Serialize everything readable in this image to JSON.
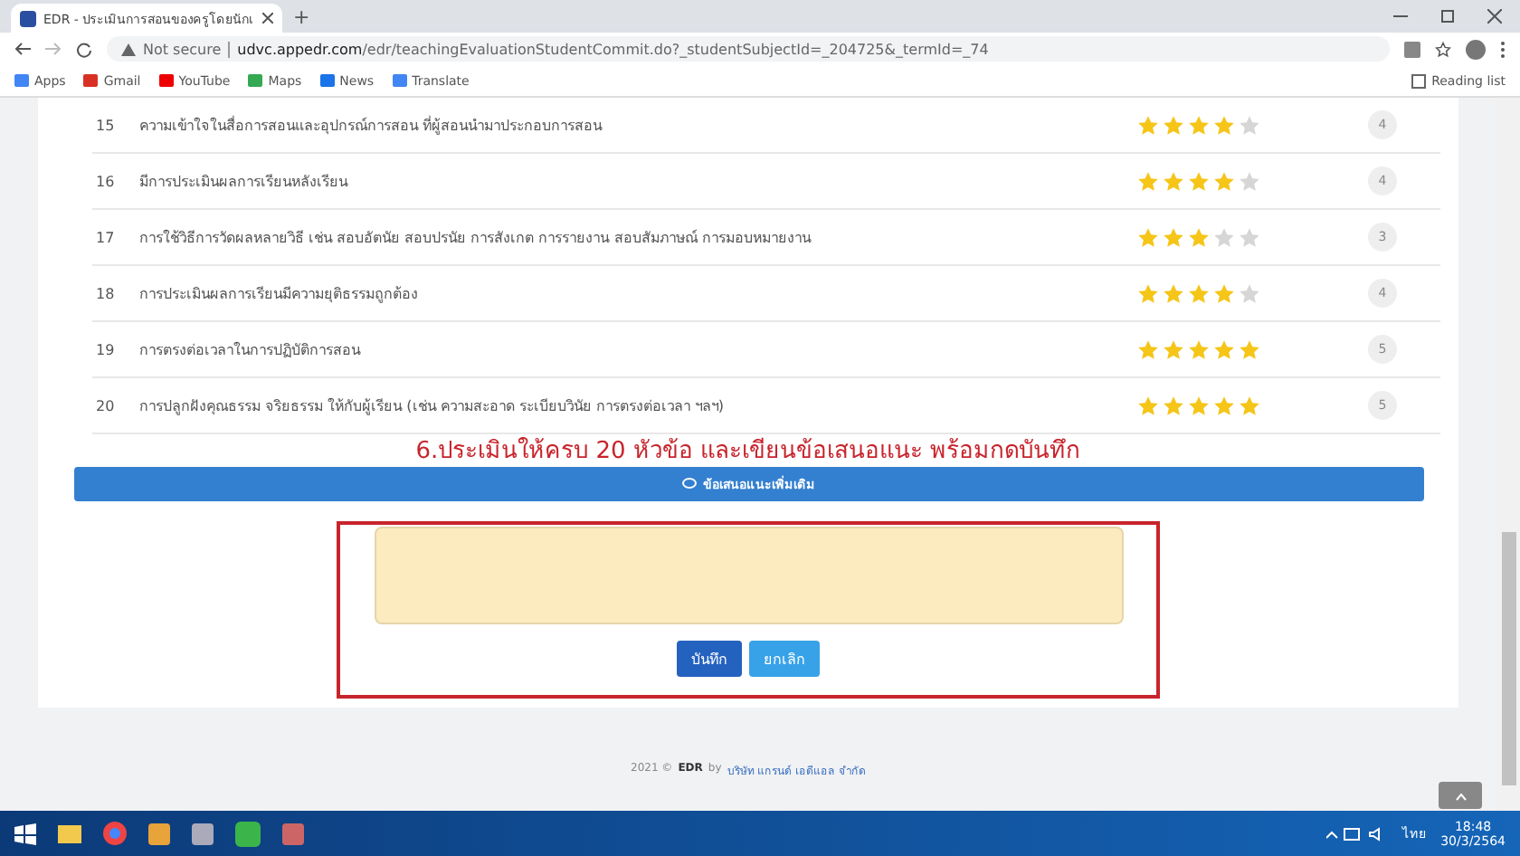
{
  "browser": {
    "tab_title": "EDR - ประเมินการสอนของครูโดยนักเ",
    "new_tab": "+",
    "url_warning": "Not secure",
    "url_host": "udvc.appedr.com",
    "url_path": "/edr/teachingEvaluationStudentCommit.do?_studentSubjectId=_204725&_termId=_74",
    "bookmarks": [
      "Apps",
      "Gmail",
      "YouTube",
      "Maps",
      "News",
      "Translate"
    ],
    "reading_list": "Reading list"
  },
  "questions": [
    {
      "number": "15",
      "text": "ความเข้าใจในสื่อการสอนและอุปกรณ์การสอน ที่ผู้สอนนำมาประกอบการสอน",
      "stars": 4,
      "score": "4"
    },
    {
      "number": "16",
      "text": "มีการประเมินผลการเรียนหลังเรียน",
      "stars": 4,
      "score": "4"
    },
    {
      "number": "17",
      "text": "การใช้วิธีการวัดผลหลายวิธี เช่น สอบอัตนัย สอบปรนัย การสังเกต การรายงาน สอบสัมภาษณ์ การมอบหมายงาน",
      "stars": 3,
      "score": "3"
    },
    {
      "number": "18",
      "text": "การประเมินผลการเรียนมีความยุติธรรมถูกต้อง",
      "stars": 4,
      "score": "4"
    },
    {
      "number": "19",
      "text": "การตรงต่อเวลาในการปฏิบัติการสอน",
      "stars": 5,
      "score": "5"
    },
    {
      "number": "20",
      "text": "การปลูกฝังคุณธรรม จริยธรรม ให้กับผู้เรียน (เช่น ความสะอาด ระเบียบวินัย การตรงต่อเวลา ฯลฯ)",
      "stars": 5,
      "score": "5"
    }
  ],
  "annotation": "6.ประเมินให้ครบ 20 หัวข้อ และเขียนข้อเสนอแนะ พร้อมกดบันทึก",
  "suggestion_header": "ข้อเสนอแนะเพิ่มเติม",
  "buttons": [
    {
      "label": "บันทึก",
      "kind": "primary"
    },
    {
      "label": "ยกเลิก",
      "kind": "secondary"
    }
  ],
  "footer": {
    "year": "2021 ©",
    "brand": "EDR",
    "by": "by",
    "company": "บริษัท แกรนด์ เอดีแอล จำกัด"
  },
  "taskbar": {
    "language": "ไทย",
    "time": "18:48",
    "date": "30/3/2564"
  }
}
